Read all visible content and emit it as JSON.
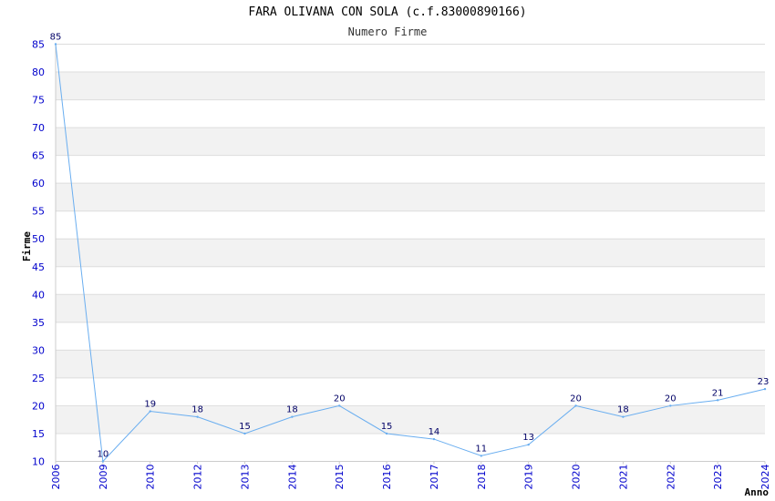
{
  "chart_data": {
    "type": "line",
    "title": "FARA OLIVANA CON SOLA (c.f.83000890166)",
    "subtitle": "Numero Firme",
    "xlabel": "Anno",
    "ylabel": "Firme",
    "ylim": [
      10,
      85
    ],
    "ytick_step": 5,
    "grid": "horizontal alternating bands",
    "categories": [
      "2006",
      "2009",
      "2010",
      "2012",
      "2013",
      "2014",
      "2015",
      "2016",
      "2017",
      "2018",
      "2019",
      "2020",
      "2021",
      "2022",
      "2023",
      "2024"
    ],
    "series": [
      {
        "values": [
          85,
          10,
          19,
          18,
          15,
          18,
          20,
          15,
          14,
          11,
          13,
          20,
          18,
          20,
          21,
          23
        ]
      }
    ],
    "colors": {
      "line": "#6aaef0",
      "band": "#f2f2f2",
      "gridline": "#dddddd",
      "tick_text": "#0000cc",
      "label_text": "#000066"
    }
  }
}
